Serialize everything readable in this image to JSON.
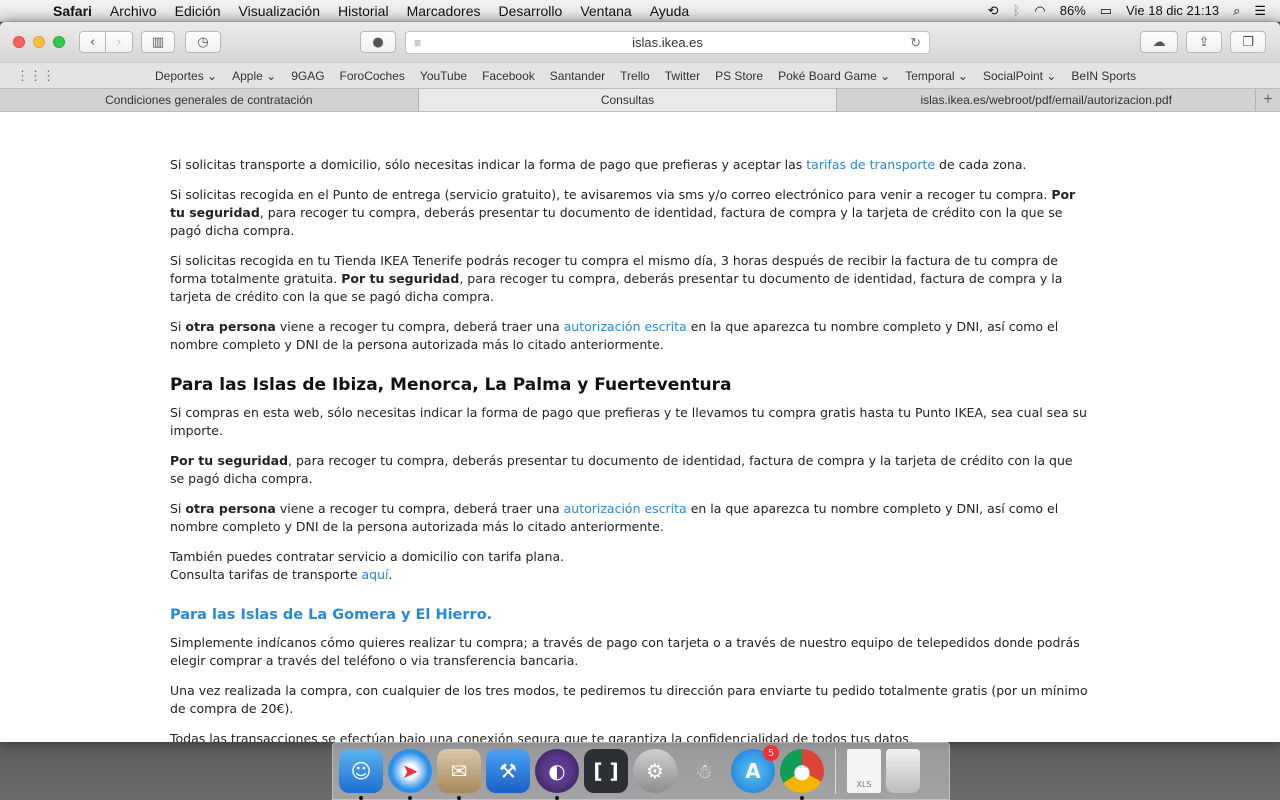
{
  "menubar": {
    "apple": "",
    "items": [
      "Safari",
      "Archivo",
      "Edición",
      "Visualización",
      "Historial",
      "Marcadores",
      "Desarrollo",
      "Ventana",
      "Ayuda"
    ],
    "battery": "86%",
    "datetime": "Vie 18 dic  21:13"
  },
  "toolbar": {
    "url": "islas.ikea.es"
  },
  "favorites": [
    "Deportes ⌄",
    "Apple ⌄",
    "9GAG",
    "ForoCoches",
    "YouTube",
    "Facebook",
    "Santander",
    "Trello",
    "Twitter",
    "PS Store",
    "Poké Board Game ⌄",
    "Temporal ⌄",
    "SocialPoint ⌄",
    "BeIN Sports"
  ],
  "tabs": [
    {
      "label": "Condiciones generales de contratación"
    },
    {
      "label": "Consultas"
    },
    {
      "label": "islas.ikea.es/webroot/pdf/email/autorizacion.pdf"
    }
  ],
  "article": {
    "p1_a": "Si solicitas transporte a domicilio, sólo necesitas indicar la forma de pago que prefieras y aceptar las ",
    "p1_link": "tarifas de transporte",
    "p1_b": " de cada zona.",
    "p2_a": "Si solicitas recogida en el Punto de entrega (servicio gratuito), te avisaremos via sms y/o correo electrónico para venir a recoger tu compra. ",
    "p2_bold": "Por tu seguridad",
    "p2_b": ", para recoger tu compra, deberás presentar tu documento de identidad, factura de compra y la tarjeta de crédito con la que se pagó dicha compra.",
    "p3_a": "Si solicitas recogida en tu Tienda IKEA Tenerife podrás recoger tu compra el mismo día, 3 horas después de recibir la factura de tu compra de forma totalmente gratuita. ",
    "p3_bold": "Por tu seguridad",
    "p3_b": ", para recoger tu compra, deberás presentar tu documento de identidad, factura de compra y la tarjeta de crédito con la que se pagó dicha compra.",
    "p4_a": "Si ",
    "p4_bold": "otra persona",
    "p4_b": " viene a recoger tu compra, deberá traer una ",
    "p4_link": "autorización escrita",
    "p4_c": " en la que aparezca tu nombre completo y DNI, así como el nombre completo y DNI de la persona autorizada más lo citado anteriormente.",
    "h2": "Para las Islas de Ibiza, Menorca, La Palma y Fuerteventura",
    "p5": "Si compras en esta web, sólo necesitas indicar la forma de pago que prefieras y te llevamos tu compra gratis hasta tu Punto IKEA, sea cual sea su importe.",
    "p6_bold": "Por tu seguridad",
    "p6_b": ", para recoger tu compra, deberás presentar tu documento de identidad, factura de compra y la tarjeta de crédito con la que se pagó dicha compra.",
    "p7_a": "Si ",
    "p7_bold": "otra persona",
    "p7_b": " viene a recoger tu compra, deberá traer una ",
    "p7_link": "autorización escrita",
    "p7_c": " en la que aparezca tu nombre completo y DNI, así como el nombre completo y DNI de la persona autorizada más lo citado anteriormente.",
    "p8_line1": "También puedes contratar servicio a domicilio con tarifa plana.",
    "p8_line2": "Consulta tarifas de transporte ",
    "p8_link": "aquí",
    "p8_end": ".",
    "h3": "Para las Islas de La Gomera y El Hierro.",
    "p9": "Simplemente indícanos cómo quieres realizar tu compra; a través de pago con tarjeta o a través de nuestro equipo de telepedidos donde podrás elegir comprar a través del teléfono o via transferencia bancaria.",
    "p10": "Una vez realizada la compra, con cualquier de los tres modos, te pediremos tu dirección para enviarte tu pedido totalmente gratis (por un mínimo de compra de 20€).",
    "p11": "Todas las transacciones se efectúan bajo una conexión segura que te garantiza la confidencialidad de todos tus datos."
  },
  "dock": {
    "appstore_badge": "5",
    "xls_label": "XLS"
  }
}
